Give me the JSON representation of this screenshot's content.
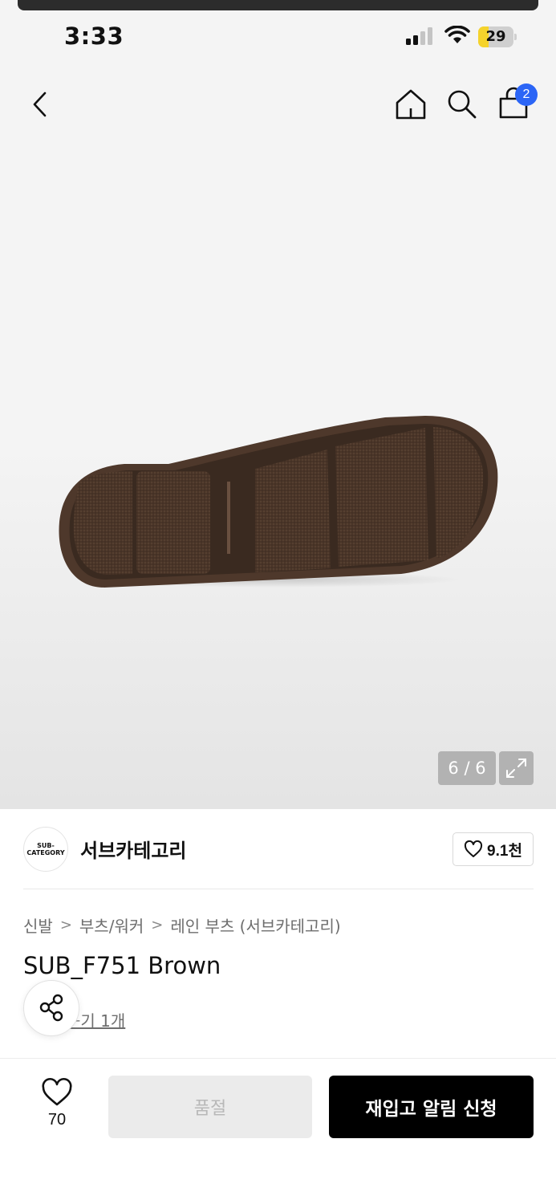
{
  "status_bar": {
    "time": "3:33",
    "battery": "29",
    "battery_level": 0.29
  },
  "header": {
    "back_icon": "chevron-left-icon",
    "home_icon": "home-icon",
    "search_icon": "search-icon",
    "cart_icon": "shopping-bag-icon",
    "cart_count": "2"
  },
  "gallery": {
    "counter": "6 / 6",
    "expand_icon": "expand-icon"
  },
  "brand": {
    "logo_line1": "SUB-",
    "logo_line2": "CATEGORY",
    "name": "서브카테고리",
    "like_count": "9.1천"
  },
  "breadcrumb": {
    "items": [
      "신발",
      "부츠/워커",
      "레인 부츠 (서브카테고리)"
    ],
    "separator": ">"
  },
  "product": {
    "title": "SUB_F751 Brown",
    "review_link": "후기 1개",
    "review_link_visible": "ᅮ기 1개"
  },
  "bottom_bar": {
    "like_count": "70",
    "soldout_label": "품절",
    "restock_label": "재입고 알림 신청"
  },
  "colors": {
    "accent_blue": "#2b65f6",
    "black": "#000000",
    "disabled_bg": "#ebebeb",
    "disabled_text": "#b8b8b8",
    "battery_yellow": "#f5d32c"
  }
}
